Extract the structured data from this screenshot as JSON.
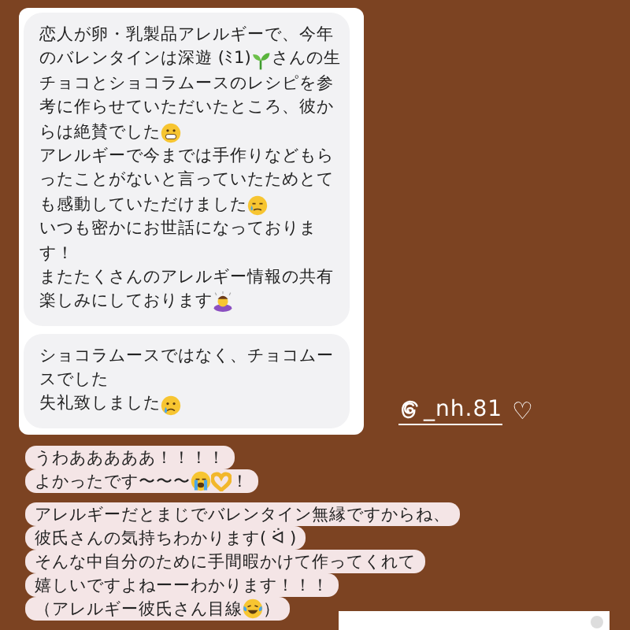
{
  "dm_card": {
    "bubbles": [
      {
        "lines": [
          [
            {
              "kind": "text",
              "text": "恋人が卵・乳製品アレルギーで、今年"
            }
          ],
          [
            {
              "kind": "text",
              "text": "のバレンタインは深遊 (ﾐ1)"
            },
            {
              "kind": "sprout"
            },
            {
              "kind": "text",
              "text": " さんの生"
            }
          ],
          [
            {
              "kind": "text",
              "text": "チョコとショコラムースのレシピを参"
            }
          ],
          [
            {
              "kind": "text",
              "text": "考に作らせていただいたところ、彼か"
            }
          ],
          [
            {
              "kind": "text",
              "text": "らは絶賛でした"
            },
            {
              "kind": "grin"
            }
          ],
          [
            {
              "kind": "text",
              "text": "アレルギーで今までは手作りなどもら"
            }
          ],
          [
            {
              "kind": "text",
              "text": "ったことがないと言っていたためとて"
            }
          ],
          [
            {
              "kind": "text",
              "text": "も感動していただけました"
            },
            {
              "kind": "teary"
            }
          ],
          [
            {
              "kind": "text",
              "text": "いつも密かにお世話になっておりま"
            }
          ],
          [
            {
              "kind": "text",
              "text": "す！"
            }
          ],
          [
            {
              "kind": "text",
              "text": "またたくさんのアレルギー情報の共有"
            }
          ],
          [
            {
              "kind": "text",
              "text": "楽しみにしております"
            },
            {
              "kind": "bow"
            }
          ]
        ]
      },
      {
        "lines": [
          [
            {
              "kind": "text",
              "text": "ショコラムースではなく、チョコムー"
            }
          ],
          [
            {
              "kind": "text",
              "text": "スでした"
            }
          ],
          [
            {
              "kind": "text",
              "text": "失礼致しました"
            },
            {
              "kind": "sad"
            }
          ]
        ]
      }
    ]
  },
  "handle": {
    "username": "_nh.81",
    "heart": "♡"
  },
  "captions": [
    {
      "lines": [
        [
          {
            "kind": "text",
            "text": "うわあああああ！！！！"
          }
        ],
        [
          {
            "kind": "text",
            "text": "よかったです〜〜〜"
          },
          {
            "kind": "sob"
          },
          {
            "kind": "hearthands"
          },
          {
            "kind": "text",
            "text": "！"
          }
        ]
      ]
    },
    {
      "lines": [
        [
          {
            "kind": "text",
            "text": "アレルギーだとまじでバレンタイン無縁ですからね、"
          }
        ],
        [
          {
            "kind": "text",
            "text": "彼氏さんの気持ちわかります( ᐛ )"
          }
        ],
        [
          {
            "kind": "text",
            "text": "そんな中自分のために手間暇かけて作ってくれて"
          }
        ],
        [
          {
            "kind": "text",
            "text": "嬉しいですよねーーわかります！！！"
          }
        ],
        [
          {
            "kind": "text",
            "text": "（アレルギー彼氏さん目線"
          },
          {
            "kind": "laugh"
          },
          {
            "kind": "text",
            "text": "）"
          }
        ]
      ]
    }
  ]
}
